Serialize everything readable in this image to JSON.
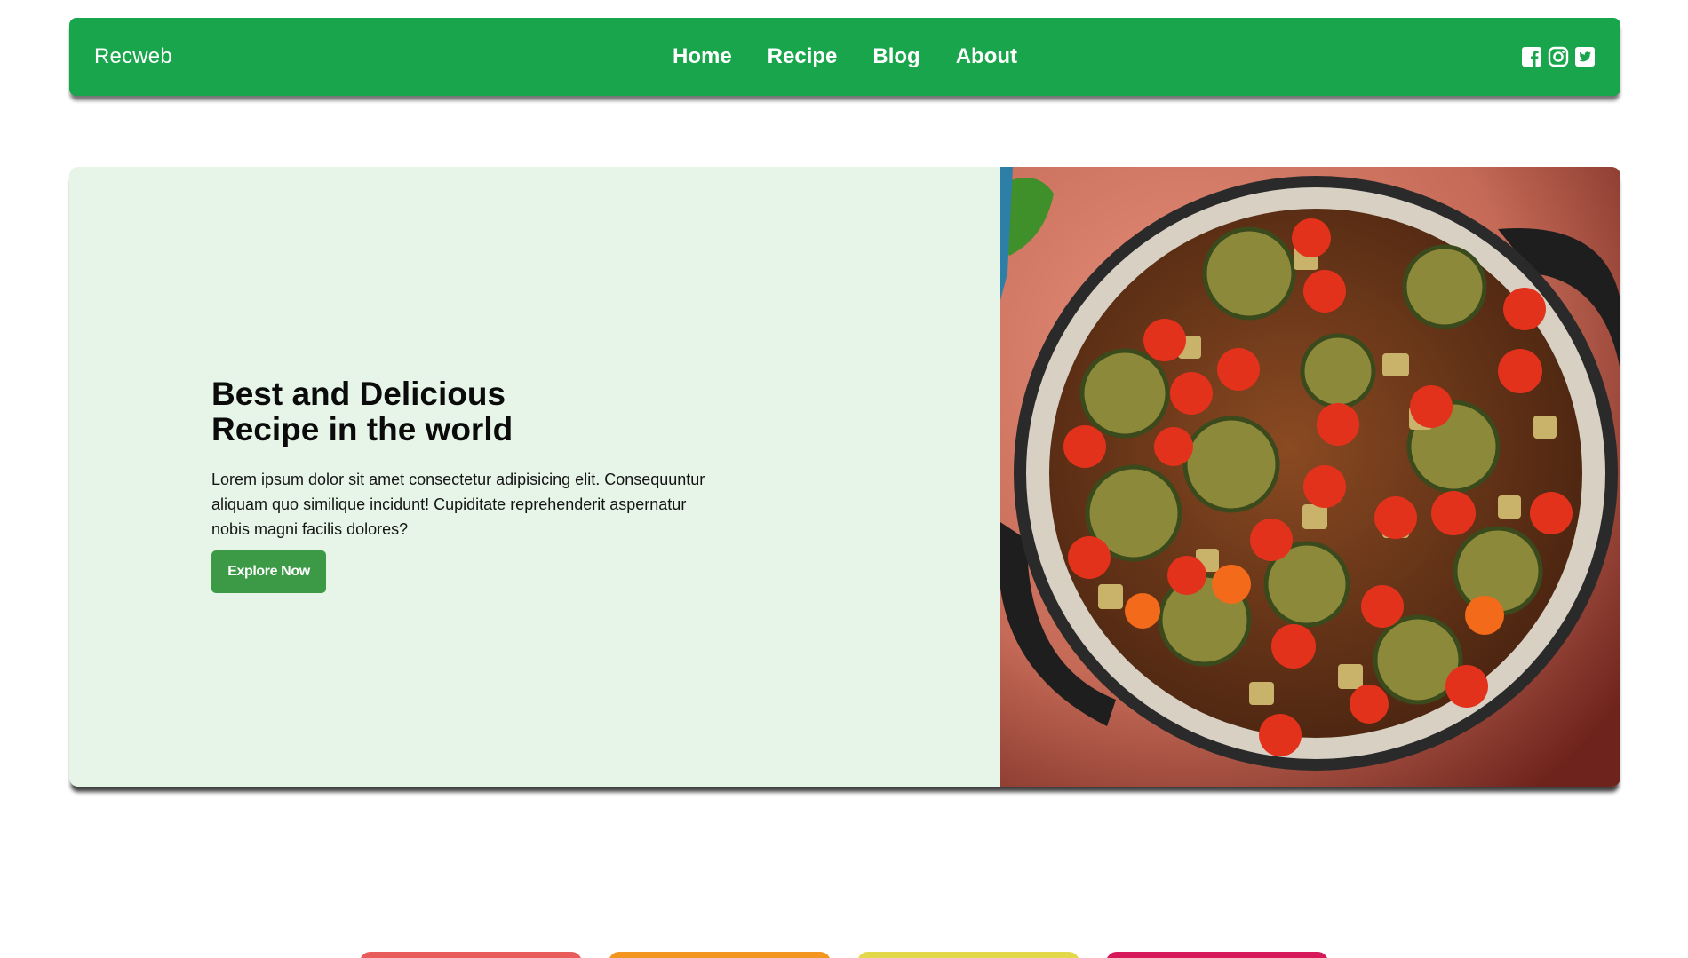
{
  "navbar": {
    "brand": "Recweb",
    "links": [
      "Home",
      "Recipe",
      "Blog",
      "About"
    ],
    "social_icons": [
      "facebook-icon",
      "instagram-icon",
      "twitter-icon"
    ],
    "bg_color": "#19a54b"
  },
  "hero": {
    "title": "Best and Delicious Recipe in the world",
    "description": "Lorem ipsum dolor sit amet consectetur adipisicing elit. Consequuntur aliquam quo similique incidunt! Cupiditate reprehenderit aspernatur nobis magni facilis dolores?",
    "cta_label": "Explore Now",
    "image_alt": "Pot of roasted vegetables with cherry tomatoes and zucchini",
    "bg_color": "#e6f5e8",
    "cta_color": "#3c9a46"
  },
  "categories": {
    "colors": [
      "#e85c5c",
      "#f2961f",
      "#e3d84a",
      "#d6195a"
    ]
  }
}
